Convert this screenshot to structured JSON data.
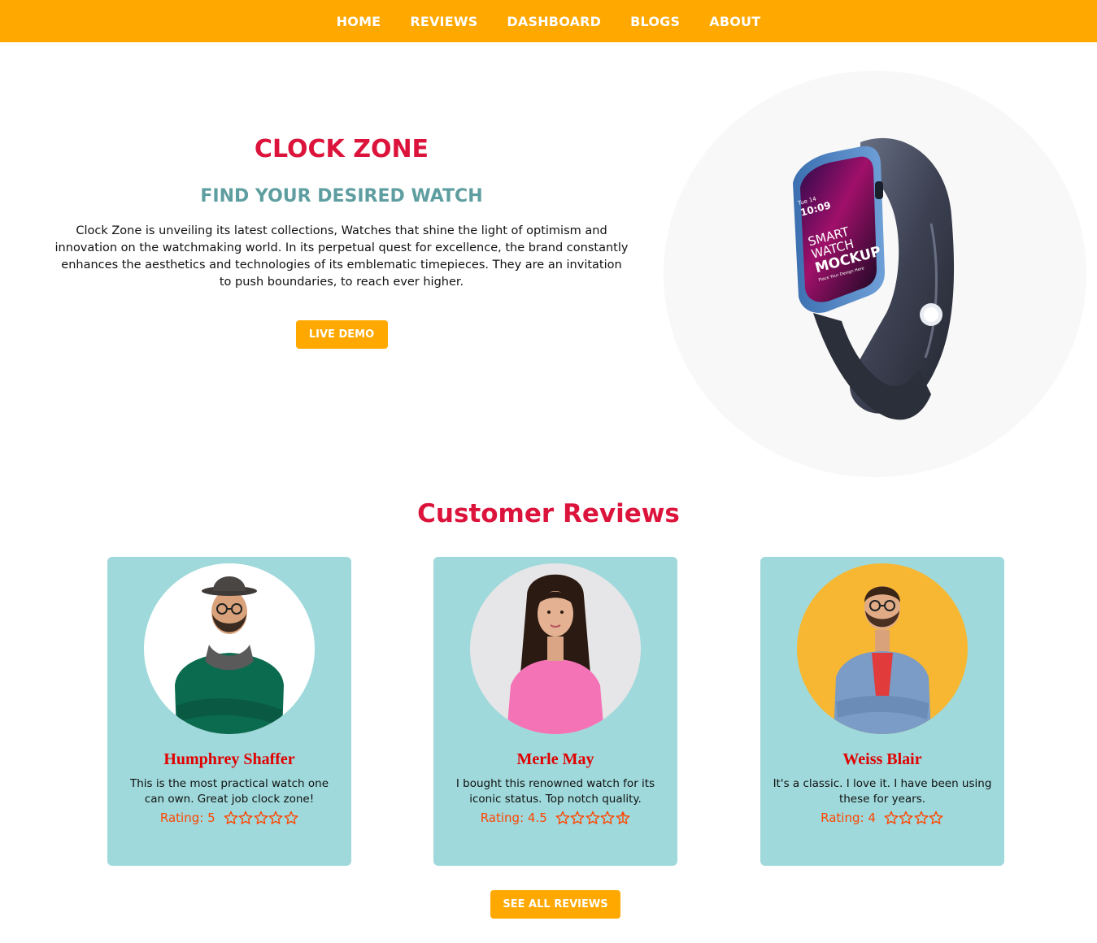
{
  "nav": {
    "items": [
      "HOME",
      "REVIEWS",
      "DASHBOARD",
      "BLOGS",
      "ABOUT"
    ]
  },
  "hero": {
    "title": "CLOCK ZONE",
    "subtitle": "FIND YOUR DESIRED WATCH",
    "description": "Clock Zone is unveiling its latest collections, Watches that shine the light of optimism and innovation on the watchmaking world. In its perpetual quest for excellence, the brand constantly enhances the aesthetics and technologies of its emblematic timepieces. They are an invitation to push boundaries, to reach ever higher.",
    "button_label": "LIVE DEMO",
    "watch_screen": {
      "date": "Tue 14",
      "time": "10:09",
      "line1": "SMART",
      "line2": "WATCH",
      "line3": "MOCKUP",
      "line4": "Place Your Design Here"
    }
  },
  "reviews": {
    "title": "Customer Reviews",
    "rating_prefix": "Rating:",
    "cards": [
      {
        "name": "Humphrey Shaffer",
        "text": "This is the most practical watch one can own. Great job clock zone!",
        "rating": "5",
        "avatar_bg": "#ffffff"
      },
      {
        "name": "Merle May",
        "text": "I bought this renowned watch for its iconic status. Top notch quality.",
        "rating": "4.5",
        "avatar_bg": "#e6e6e8"
      },
      {
        "name": "Weiss Blair",
        "text": "It's a classic. I love it. I have been using these for years.",
        "rating": "4",
        "avatar_bg": "#f7b733"
      }
    ],
    "see_all_label": "SEE ALL REVIEWS"
  },
  "colors": {
    "accent": "#ffa800",
    "title_red": "#dc143c",
    "subtitle_teal": "#5f9ea0",
    "card_bg": "#9fd9db",
    "rating": "#ff4500"
  }
}
